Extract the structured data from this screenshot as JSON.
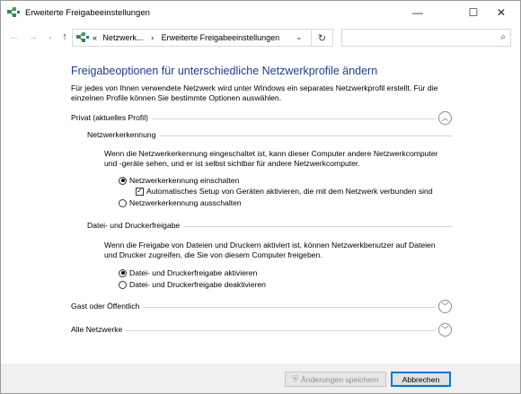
{
  "window": {
    "title": "Erweiterte Freigabeeinstellungen",
    "controls": {
      "minimize": "—",
      "maximize": "☐",
      "close": "✕"
    }
  },
  "nav": {
    "back_icon": "←",
    "forward_icon": "→",
    "recent_icon": "⌄",
    "up_icon": "↑",
    "address": {
      "prefix": "«",
      "crumb1": "Netzwerk...",
      "separator": "›",
      "crumb2": "Erweiterte Freigabeeinstellungen",
      "dropdown_icon": "⌄"
    },
    "refresh_icon": "↻",
    "search": {
      "placeholder": "",
      "icon": "⌕"
    }
  },
  "main": {
    "heading": "Freigabeoptionen für unterschiedliche Netzwerkprofile ändern",
    "description": "Für jedes von Ihnen verwendete Netzwerk wird unter Windows ein separates Netzwerkprofil erstellt. Für die einzelnen Profile können Sie bestimmte Optionen auswählen.",
    "profiles": {
      "private": {
        "label": "Privat (aktuelles Profil)",
        "chevron": "︿",
        "network_discovery": {
          "label": "Netzwerkerkennung",
          "text": "Wenn die Netzwerkerkennung eingeschaltet ist, kann dieser Computer andere Netzwerkcomputer und -geräte sehen, und er ist selbst sichtbar für andere Netzwerkcomputer.",
          "opt_on": "Netzwerkerkennung einschalten",
          "auto_setup": "Automatisches Setup von Geräten aktivieren, die mit dem Netzwerk verbunden sind",
          "opt_off": "Netzwerkerkennung ausschalten",
          "check_mark": "✓"
        },
        "file_printer": {
          "label": "Datei- und Druckerfreigabe",
          "text": "Wenn die Freigabe von Dateien und Druckern aktiviert ist, können Netzwerkbenutzer auf Dateien und Drucker zugreifen, die Sie von diesem Computer freigeben.",
          "opt_on": "Datei- und Druckerfreigabe aktivieren",
          "opt_off": "Datei- und Druckerfreigabe deaktivieren"
        }
      },
      "guest": {
        "label": "Gast oder Öffentlich",
        "chevron": "﹀"
      },
      "all": {
        "label": "Alle Netzwerke",
        "chevron": "﹀"
      }
    }
  },
  "footer": {
    "save_label": "Änderungen speichern",
    "save_icon": "⛨",
    "cancel_label": "Abbrechen"
  },
  "colors": {
    "heading": "#1e3d8f",
    "accent": "#0078d7",
    "footer_bg": "#f0f0f0"
  }
}
